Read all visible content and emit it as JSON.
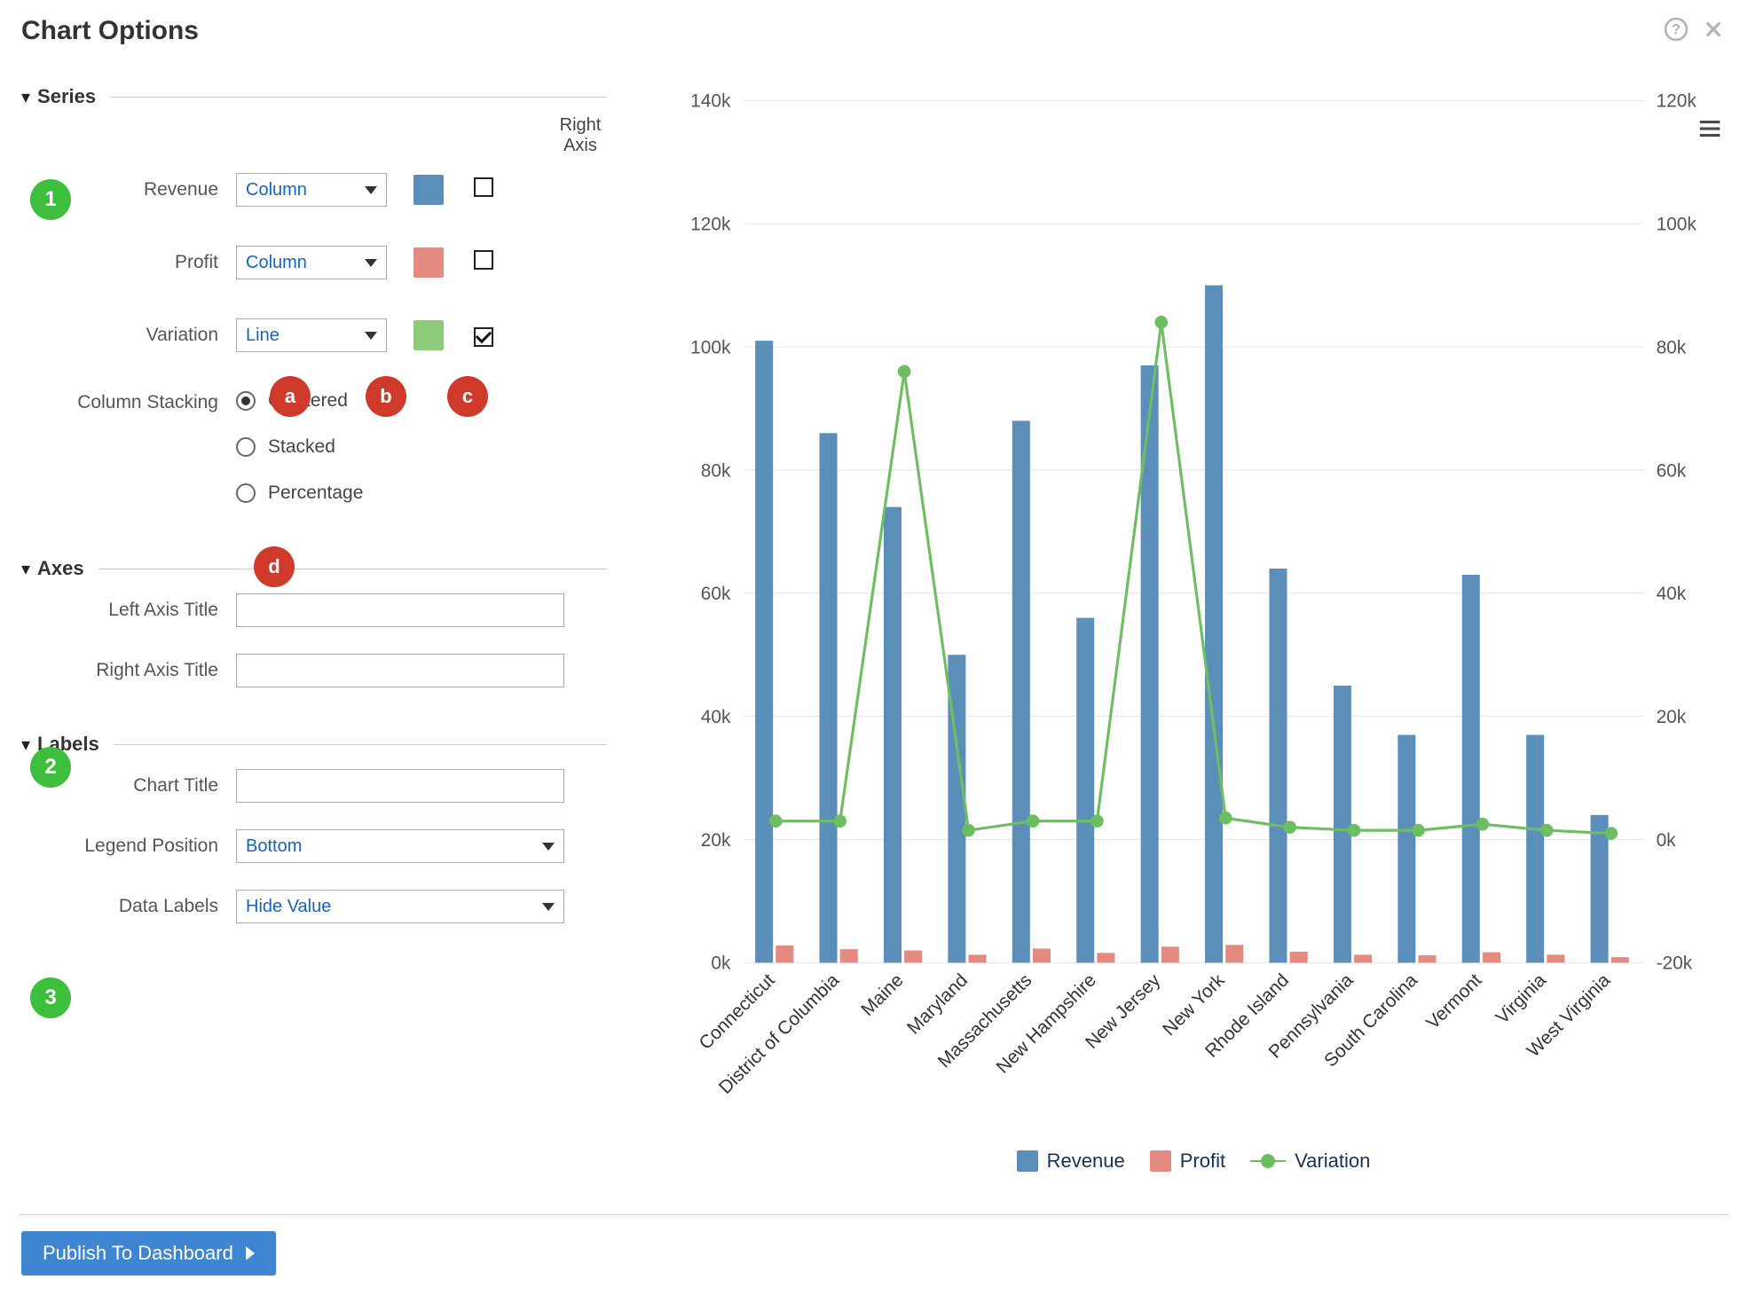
{
  "dialog": {
    "title": "Chart Options"
  },
  "sections": {
    "series": {
      "label": "Series",
      "right_axis_header": "Right Axis",
      "rows": [
        {
          "name": "Revenue",
          "type": "Column",
          "color": "#5B8FB9",
          "right_axis": false
        },
        {
          "name": "Profit",
          "type": "Column",
          "color": "#E58A80",
          "right_axis": false
        },
        {
          "name": "Variation",
          "type": "Line",
          "color": "#8FCC7A",
          "right_axis": true
        }
      ],
      "stacking": {
        "label": "Column Stacking",
        "options": [
          "Clustered",
          "Stacked",
          "Percentage"
        ],
        "selected": "Clustered"
      }
    },
    "axes": {
      "label": "Axes",
      "left_title_label": "Left Axis Title",
      "left_title_value": "",
      "right_title_label": "Right Axis Title",
      "right_title_value": ""
    },
    "labels": {
      "label": "Labels",
      "chart_title_label": "Chart Title",
      "chart_title_value": "",
      "legend_position_label": "Legend Position",
      "legend_position_value": "Bottom",
      "data_labels_label": "Data Labels",
      "data_labels_value": "Hide Value"
    }
  },
  "publish_button": "Publish To Dashboard",
  "callouts_green": {
    "1": "1",
    "2": "2",
    "3": "3"
  },
  "callouts_red": {
    "a": "a",
    "b": "b",
    "c": "c",
    "d": "d"
  },
  "legend": {
    "revenue": "Revenue",
    "profit": "Profit",
    "variation": "Variation"
  },
  "chart_data": {
    "type": "bar+line",
    "categories": [
      "Connecticut",
      "District of Columbia",
      "Maine",
      "Maryland",
      "Massachusetts",
      "New Hampshire",
      "New Jersey",
      "New York",
      "Rhode Island",
      "Pennsylvania",
      "South Carolina",
      "Vermont",
      "Virginia",
      "West Virginia"
    ],
    "series": [
      {
        "name": "Revenue",
        "type": "Column",
        "axis": "left",
        "color": "#5B8FB9",
        "values": [
          101000,
          86000,
          74000,
          50000,
          88000,
          56000,
          97000,
          110000,
          64000,
          45000,
          37000,
          63000,
          37000,
          24000
        ]
      },
      {
        "name": "Profit",
        "type": "Column",
        "axis": "left",
        "color": "#E58A80",
        "values": [
          2800,
          2200,
          2000,
          1300,
          2300,
          1600,
          2600,
          2900,
          1800,
          1300,
          1200,
          1700,
          1300,
          900
        ]
      },
      {
        "name": "Variation",
        "type": "Line",
        "axis": "right",
        "color": "#6DBE60",
        "values": [
          3000,
          3000,
          76000,
          1500,
          3000,
          3000,
          84000,
          3500,
          2000,
          1500,
          1500,
          2500,
          1500,
          1000
        ]
      }
    ],
    "left_axis": {
      "min": 0,
      "max": 140000,
      "ticks": [
        "0k",
        "20k",
        "40k",
        "60k",
        "80k",
        "100k",
        "120k",
        "140k"
      ]
    },
    "right_axis": {
      "min": -20000,
      "max": 120000,
      "ticks": [
        "-20k",
        "0k",
        "20k",
        "40k",
        "60k",
        "80k",
        "100k",
        "120k"
      ]
    },
    "legend_position": "Bottom"
  }
}
